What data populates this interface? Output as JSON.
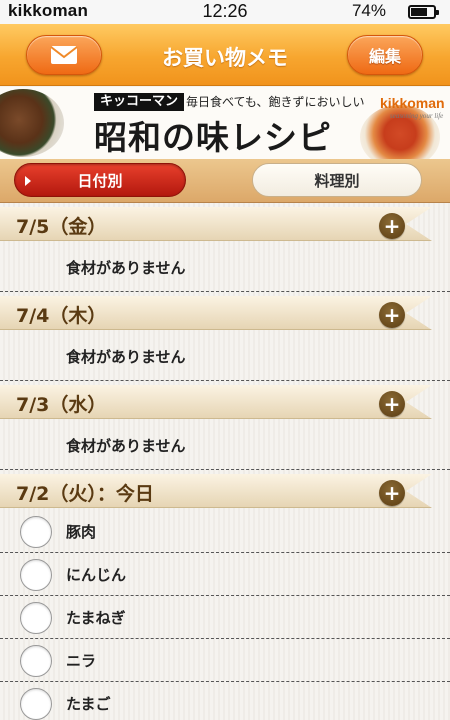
{
  "status_bar": {
    "carrier": "kikkoman",
    "time": "12:26",
    "battery_text": "74%",
    "battery_level": 0.74
  },
  "nav": {
    "title": "お買い物メモ",
    "mail_icon": "envelope-icon",
    "edit_label": "編集"
  },
  "banner": {
    "tag": "キッコーマン",
    "subtitle": "毎日食べても、飽きずにおいしい",
    "title": "昭和の味レシピ",
    "logo_text": "kikkoman",
    "logo_tagline": "seasoning your life"
  },
  "segments": {
    "by_date": "日付別",
    "by_dish": "料理別",
    "selected": "by_date"
  },
  "sections": [
    {
      "date": "7/5（金）",
      "empty_text": "食材がありません",
      "items": []
    },
    {
      "date": "7/4（木）",
      "empty_text": "食材がありません",
      "items": []
    },
    {
      "date": "7/3（水）",
      "empty_text": "食材がありません",
      "items": []
    },
    {
      "date": "7/2（火）：今日",
      "empty_text": "",
      "items": [
        "豚肉",
        "にんじん",
        "たまねぎ",
        "ニラ",
        "たまご"
      ]
    }
  ],
  "colors": {
    "nav_orange": "#f7a62f",
    "selected_segment": "#c8281a",
    "date_text": "#5a3a12",
    "add_button": "#6e4e22"
  }
}
